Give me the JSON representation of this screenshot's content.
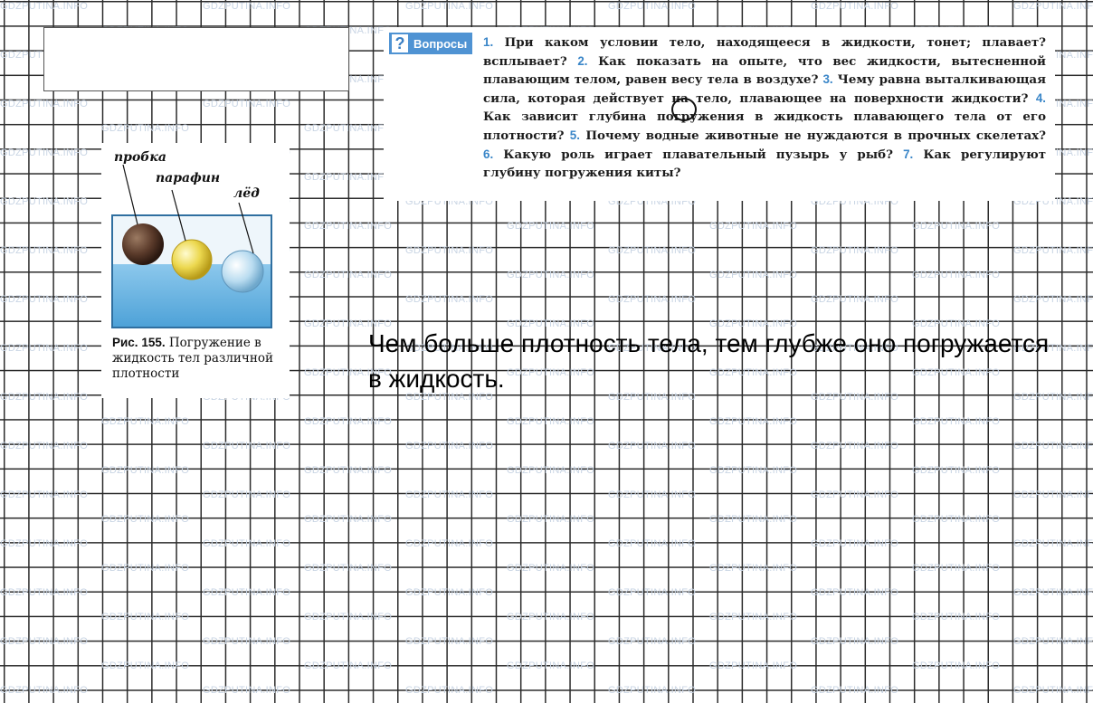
{
  "watermark": "GDZPUTINA.INFO",
  "questions": {
    "header_icon": "?",
    "header_label": "Вопросы",
    "items": [
      {
        "num": "1.",
        "text": "При каком условии тело, находящееся в жидкости, тонет; плавает? всплывает?"
      },
      {
        "num": "2.",
        "text": "Как показать на опыте, что вес жидкости, вытесненной плавающим телом, равен весу тела в воздухе?"
      },
      {
        "num": "3.",
        "text": "Чему равна выталкивающая сила, которая действует на тело, плавающее на поверхности жидкости?"
      },
      {
        "num": "4.",
        "text": "Как зависит глубина погружения в жидкость плавающего тела от его плотности?"
      },
      {
        "num": "5.",
        "text": "Почему водные животные не нуждаются в прочных скелетах?"
      },
      {
        "num": "6.",
        "text": "Какую роль играет плавательный пузырь у рыб?"
      },
      {
        "num": "7.",
        "text": "Как регулируют глубину погружения киты?"
      }
    ]
  },
  "figure": {
    "labels": {
      "cork": "пробка",
      "paraffin": "парафин",
      "ice": "лёд"
    },
    "caption_num": "Рис. 155.",
    "caption_text": "Погружение в жидкость тел различной плотности"
  },
  "answer": "Чем больше плотность тела, тем глубже оно погружается в жидкость.",
  "colors": {
    "accent": "#4f93d3",
    "water": "#6fb7e4",
    "cork": "#5a3a2a",
    "paraffin": "#e8d24a",
    "ice": "#b9dcf0"
  }
}
